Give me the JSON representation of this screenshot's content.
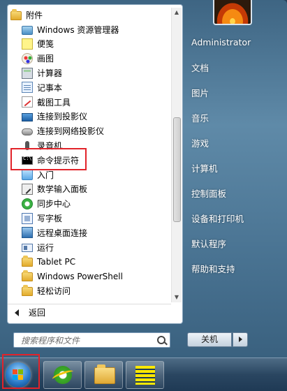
{
  "programs": {
    "items": [
      {
        "label": "附件",
        "icon": "folder-icon",
        "level": 0
      },
      {
        "label": "Windows 资源管理器",
        "icon": "windows-explorer-icon",
        "level": 1
      },
      {
        "label": "便笺",
        "icon": "sticky-notes-icon",
        "level": 1
      },
      {
        "label": "画图",
        "icon": "paint-icon",
        "level": 1
      },
      {
        "label": "计算器",
        "icon": "calculator-icon",
        "level": 1
      },
      {
        "label": "记事本",
        "icon": "notepad-icon",
        "level": 1
      },
      {
        "label": "截图工具",
        "icon": "snipping-tool-icon",
        "level": 1
      },
      {
        "label": "连接到投影仪",
        "icon": "projector-icon",
        "level": 1
      },
      {
        "label": "连接到网络投影仪",
        "icon": "network-projector-icon",
        "level": 1
      },
      {
        "label": "录音机",
        "icon": "microphone-icon",
        "level": 1
      },
      {
        "label": "命令提示符",
        "icon": "command-prompt-icon",
        "level": 1
      },
      {
        "label": "入门",
        "icon": "getting-started-icon",
        "level": 1
      },
      {
        "label": "数学输入面板",
        "icon": "math-input-icon",
        "level": 1
      },
      {
        "label": "同步中心",
        "icon": "sync-center-icon",
        "level": 1
      },
      {
        "label": "写字板",
        "icon": "wordpad-icon",
        "level": 1
      },
      {
        "label": "远程桌面连接",
        "icon": "remote-desktop-icon",
        "level": 1
      },
      {
        "label": "运行",
        "icon": "run-icon",
        "level": 1
      },
      {
        "label": "Tablet PC",
        "icon": "folder-icon",
        "level": 1
      },
      {
        "label": "Windows PowerShell",
        "icon": "folder-icon",
        "level": 1
      },
      {
        "label": "轻松访问",
        "icon": "folder-icon",
        "level": 1
      }
    ],
    "back_label": "返回"
  },
  "search": {
    "placeholder": "搜索程序和文件",
    "value": ""
  },
  "right_menu": {
    "items": [
      "Administrator",
      "文档",
      "图片",
      "音乐",
      "游戏",
      "计算机",
      "控制面板",
      "设备和打印机",
      "默认程序",
      "帮助和支持"
    ]
  },
  "shutdown": {
    "label": "关机"
  },
  "taskbar": {
    "items": [
      "start-orb",
      "internet-explorer-icon",
      "windows-explorer-icon",
      "sticky-notes-icon"
    ]
  },
  "colors": {
    "highlight": "#e2232a",
    "menu_bg": "#4a7493",
    "taskbar_bg": "#2a4661"
  }
}
